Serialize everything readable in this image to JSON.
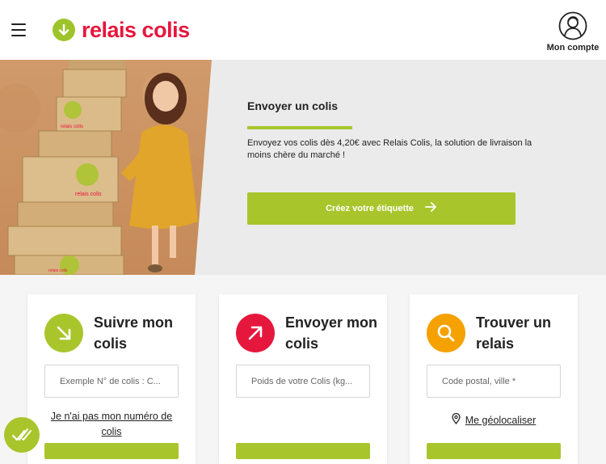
{
  "header": {
    "menu_icon": "hamburger-menu-icon",
    "logo_text": "relais colis",
    "account_label": "Mon compte"
  },
  "hero": {
    "title": "Envoyer un colis",
    "text": "Envoyez vos colis dès 4,20€ avec Relais Colis, la solution de livraison la moins chère du marché !",
    "button_label": "Créez votre étiquette",
    "photo_box_labels": [
      "relais colis",
      "relais colis",
      "relais colis"
    ]
  },
  "cards": [
    {
      "title": "Suivre mon colis",
      "icon": "arrow-down-right-icon",
      "color": "#a8c62c",
      "placeholder": "Exemple N° de colis : C...",
      "link": "Je n'ai pas mon numéro de colis"
    },
    {
      "title": "Envoyer mon colis",
      "icon": "arrow-up-right-icon",
      "color": "#e6173d",
      "placeholder": "Poids de votre Colis (kg..."
    },
    {
      "title": "Trouver un relais",
      "icon": "search-icon",
      "color": "#f5a100",
      "placeholder": "Code postal, ville *",
      "link": "Me géolocaliser"
    }
  ],
  "colors": {
    "brand_red": "#e6173d",
    "brand_green": "#a8c62c",
    "accent_orange": "#f5a100"
  }
}
